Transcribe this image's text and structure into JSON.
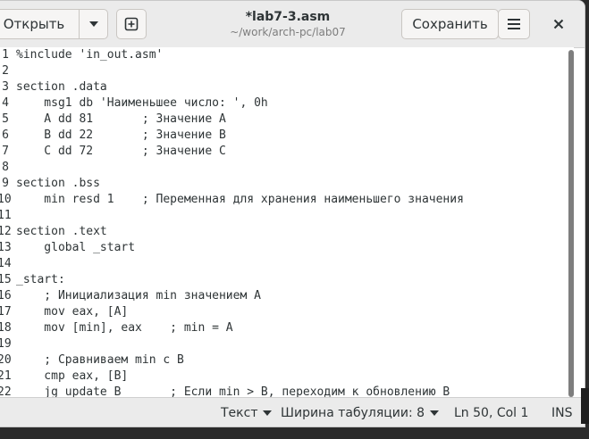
{
  "header": {
    "open_label": "Открыть",
    "save_label": "Сохранить",
    "title": "*lab7-3.asm",
    "subtitle": "~/work/arch-pc/lab07"
  },
  "editor": {
    "lines": [
      {
        "n": "1",
        "text": "%include 'in_out.asm'"
      },
      {
        "n": "2",
        "text": ""
      },
      {
        "n": "3",
        "text": "section .data"
      },
      {
        "n": "4",
        "text": "    msg1 db 'Наименьшее число: ', 0h"
      },
      {
        "n": "5",
        "text": "    A dd 81       ; Значение A"
      },
      {
        "n": "6",
        "text": "    B dd 22       ; Значение B"
      },
      {
        "n": "7",
        "text": "    C dd 72       ; Значение C"
      },
      {
        "n": "8",
        "text": ""
      },
      {
        "n": "9",
        "text": "section .bss"
      },
      {
        "n": "10",
        "text": "    min resd 1    ; Переменная для хранения наименьшего значения"
      },
      {
        "n": "11",
        "text": ""
      },
      {
        "n": "12",
        "text": "section .text"
      },
      {
        "n": "13",
        "text": "    global _start"
      },
      {
        "n": "14",
        "text": ""
      },
      {
        "n": "15",
        "text": "_start:"
      },
      {
        "n": "16",
        "text": "    ; Инициализация min значением A"
      },
      {
        "n": "17",
        "text": "    mov eax, [A]"
      },
      {
        "n": "18",
        "text": "    mov [min], eax    ; min = A"
      },
      {
        "n": "19",
        "text": ""
      },
      {
        "n": "20",
        "text": "    ; Сравниваем min с B"
      },
      {
        "n": "21",
        "text": "    cmp eax, [B]"
      },
      {
        "n": "22",
        "text": "    jg update_B       ; Если min > B, переходим к обновлению B"
      }
    ]
  },
  "statusbar": {
    "language": "Текст",
    "tab_width": "Ширина табуляции: 8",
    "position": "Ln 50, Col 1",
    "mode": "INS"
  }
}
